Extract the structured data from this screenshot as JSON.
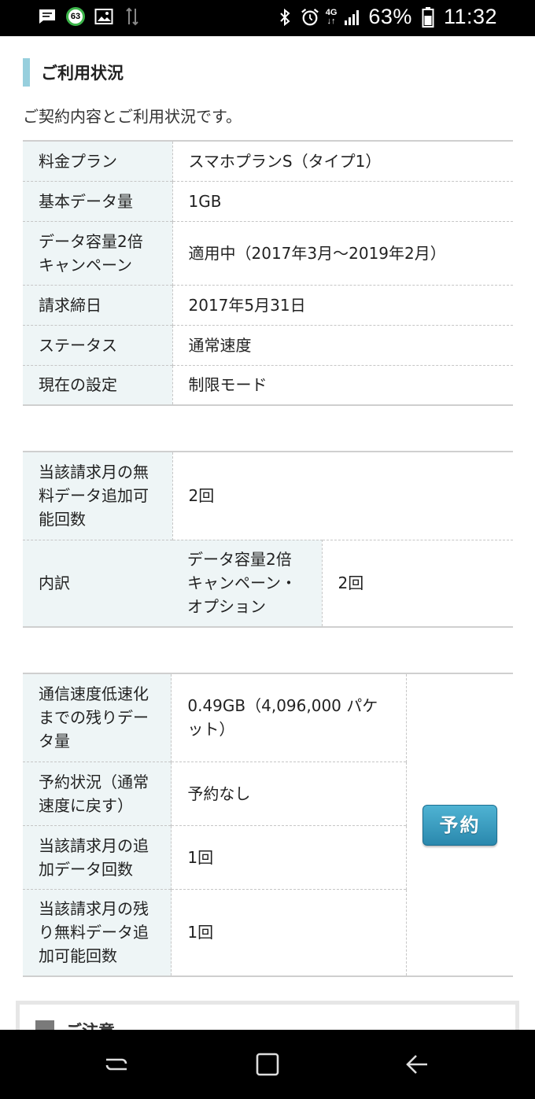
{
  "status_bar": {
    "notification_badge": "63",
    "network": "4G",
    "battery_percent": "63%",
    "time": "11:32"
  },
  "section": {
    "title": "ご利用状況",
    "lead": "ご契約内容とご利用状況です。"
  },
  "contract_table": [
    {
      "label": "料金プラン",
      "value": "スマホプランS（タイプ1）"
    },
    {
      "label": "基本データ量",
      "value": "1GB"
    },
    {
      "label": "データ容量2倍キャンペーン",
      "value": "適用中（2017年3月〜2019年2月）"
    },
    {
      "label": "請求締日",
      "value": "2017年5月31日"
    },
    {
      "label": "ステータス",
      "value": "通常速度"
    },
    {
      "label": "現在の設定",
      "value": "制限モード"
    }
  ],
  "free_data_table": {
    "main_label": "当該請求月の無料データ追加可能回数",
    "main_value": "2回",
    "breakdown_label": "内訳",
    "breakdown_item": "データ容量2倍キャンペーン・オプション",
    "breakdown_value": "2回"
  },
  "usage_table": [
    {
      "label": "通信速度低速化までの残りデータ量",
      "value": "0.49GB（4,096,000 パケット）"
    },
    {
      "label": "予約状況（通常速度に戻す）",
      "value": "予約なし"
    },
    {
      "label": "当該請求月の追加データ回数",
      "value": "1回"
    },
    {
      "label": "当該請求月の残り無料データ追加可能回数",
      "value": "1回"
    }
  ],
  "reserve_button": "予約",
  "notice": {
    "title": "ご注意"
  },
  "icons": [
    "message-icon",
    "gallery-icon",
    "data-transfer-icon",
    "bluetooth-icon",
    "alarm-icon",
    "signal-icon",
    "battery-icon",
    "nav-recent-icon",
    "nav-home-icon",
    "nav-back-icon",
    "notice-icon"
  ]
}
